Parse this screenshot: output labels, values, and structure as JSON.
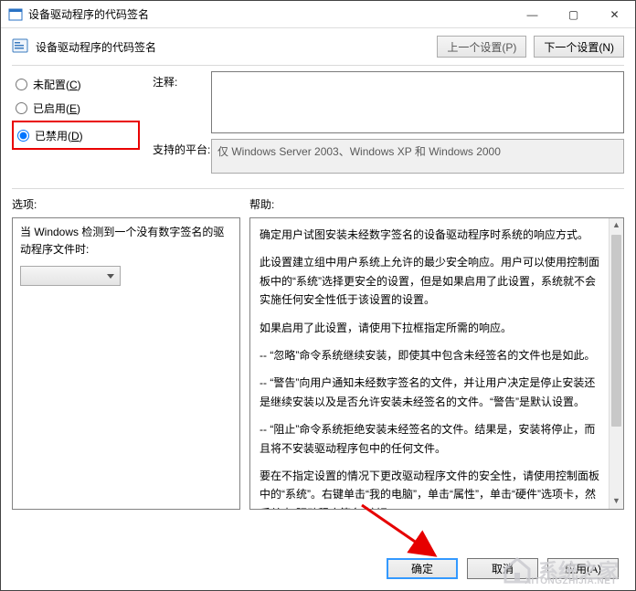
{
  "titlebar": {
    "title": "设备驱动程序的代码签名"
  },
  "header": {
    "policy_title": "设备驱动程序的代码签名",
    "prev_setting": "上一个设置(P)",
    "next_setting": "下一个设置(N)"
  },
  "radios": {
    "not_configured": {
      "label": "未配置(",
      "accel": "C",
      "suffix": ")"
    },
    "enabled": {
      "label": "已启用(",
      "accel": "E",
      "suffix": ")"
    },
    "disabled": {
      "label": "已禁用(",
      "accel": "D",
      "suffix": ")"
    }
  },
  "comment": {
    "label": "注释:",
    "value": ""
  },
  "platform": {
    "label": "支持的平台:",
    "value": "仅 Windows Server 2003、Windows XP 和 Windows 2000"
  },
  "sections": {
    "options_label": "选项:",
    "help_label": "帮助:"
  },
  "options": {
    "text": "当 Windows 检测到一个没有数字签名的驱动程序文件时:"
  },
  "help": {
    "p1": "确定用户试图安装未经数字签名的设备驱动程序时系统的响应方式。",
    "p2": "此设置建立组中用户系统上允许的最少安全响应。用户可以使用控制面板中的“系统”选择更安全的设置，但是如果启用了此设置，系统就不会实施任何安全性低于该设置的设置。",
    "p3": "如果启用了此设置，请使用下拉框指定所需的响应。",
    "p4": "-- “忽略”命令系统继续安装，即使其中包含未经签名的文件也是如此。",
    "p5": "-- “警告”向用户通知未经数字签名的文件，并让用户决定是停止安装还是继续安装以及是否允许安装未经签名的文件。“警告”是默认设置。",
    "p6": "-- “阻止”命令系统拒绝安装未经签名的文件。结果是，安装将停止，而且将不安装驱动程序包中的任何文件。",
    "p7": "要在不指定设置的情况下更改驱动程序文件的安全性，请使用控制面板中的“系统”。右键单击“我的电脑”，单击“属性”，单击“硬件”选项卡，然后单击“驱动程序签名”按钮。"
  },
  "buttons": {
    "ok": "确定",
    "cancel": "取消",
    "apply": "应用(A)"
  },
  "watermark": {
    "text": "系统之家",
    "sub": "XITONGZHIJIA.NET"
  }
}
